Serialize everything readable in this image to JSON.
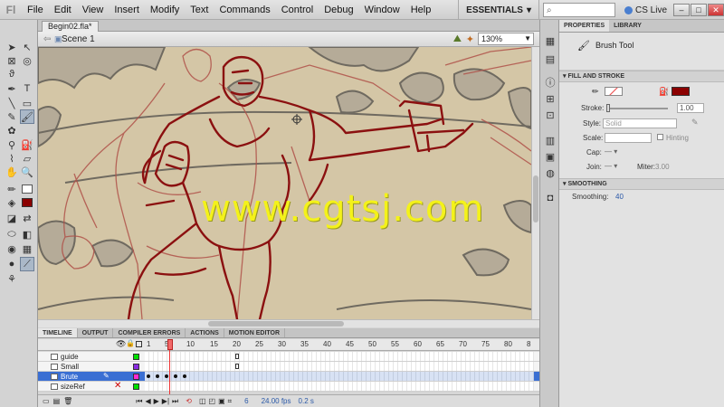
{
  "app": {
    "logo": "Fl"
  },
  "menu": [
    "File",
    "Edit",
    "View",
    "Insert",
    "Modify",
    "Text",
    "Commands",
    "Control",
    "Debug",
    "Window",
    "Help"
  ],
  "workspace": {
    "label": "ESSENTIALS",
    "cslive": "CS Live"
  },
  "document": {
    "tab": "Begin02.fla*",
    "scene": "Scene 1",
    "zoom": "130%"
  },
  "watermark": "www.cgtsj.com",
  "timeline": {
    "tabs": [
      "TIMELINE",
      "OUTPUT",
      "COMPILER ERRORS",
      "ACTIONS",
      "MOTION EDITOR"
    ],
    "frame_numbers": [
      "1",
      "5",
      "10",
      "15",
      "20",
      "25",
      "30",
      "35",
      "40",
      "45",
      "50",
      "55",
      "60",
      "65",
      "70",
      "75",
      "80",
      "8"
    ],
    "layers": [
      {
        "name": "guide",
        "color": "#00e000"
      },
      {
        "name": "Small",
        "color": "#8a2be2"
      },
      {
        "name": "Brute",
        "color": "#ff2ad4",
        "selected": true
      },
      {
        "name": "sizeRef",
        "color": "#00e000"
      }
    ],
    "current_frame": "6",
    "fps": "24.00 fps",
    "time": "0.2 s"
  },
  "properties": {
    "tabs": [
      "PROPERTIES",
      "LIBRARY"
    ],
    "tool_name": "Brush Tool",
    "fill_stroke_title": "FILL AND STROKE",
    "stroke_label": "Stroke:",
    "stroke_value": "1.00",
    "style_label": "Style:",
    "style_value": "Solid",
    "scale_label": "Scale:",
    "hinting_label": "Hinting",
    "cap_label": "Cap:",
    "join_label": "Join:",
    "miter_label": "Miter:",
    "miter_value": "3.00",
    "smoothing_title": "SMOOTHING",
    "smoothing_label": "Smoothing:",
    "smoothing_value": "40",
    "fill_color": "#8b0000"
  },
  "colors": {
    "stage_bg": "#d4c6a6",
    "sketch_red": "#8b1010",
    "sketch_light": "#b0524a",
    "rock_grey": "#9a9488"
  }
}
